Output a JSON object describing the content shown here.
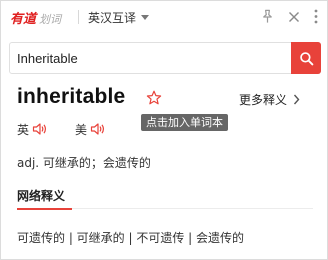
{
  "titlebar": {
    "brand_main": "有道",
    "brand_sub": "划词",
    "mode": "英汉互译"
  },
  "search": {
    "value": "Inheritable"
  },
  "entry": {
    "word": "inheritable",
    "more_definitions": "更多释义",
    "tooltip": "点击加入单词本",
    "uk_label": "英",
    "us_label": "美",
    "definition": "adj. 可继承的；会遗传的"
  },
  "web": {
    "title": "网络释义",
    "definitions": "可遗传的 | 可继承的 | 不可遗传 | 会遗传的"
  },
  "colors": {
    "accent": "#e8423a",
    "brand": "#e02020"
  }
}
